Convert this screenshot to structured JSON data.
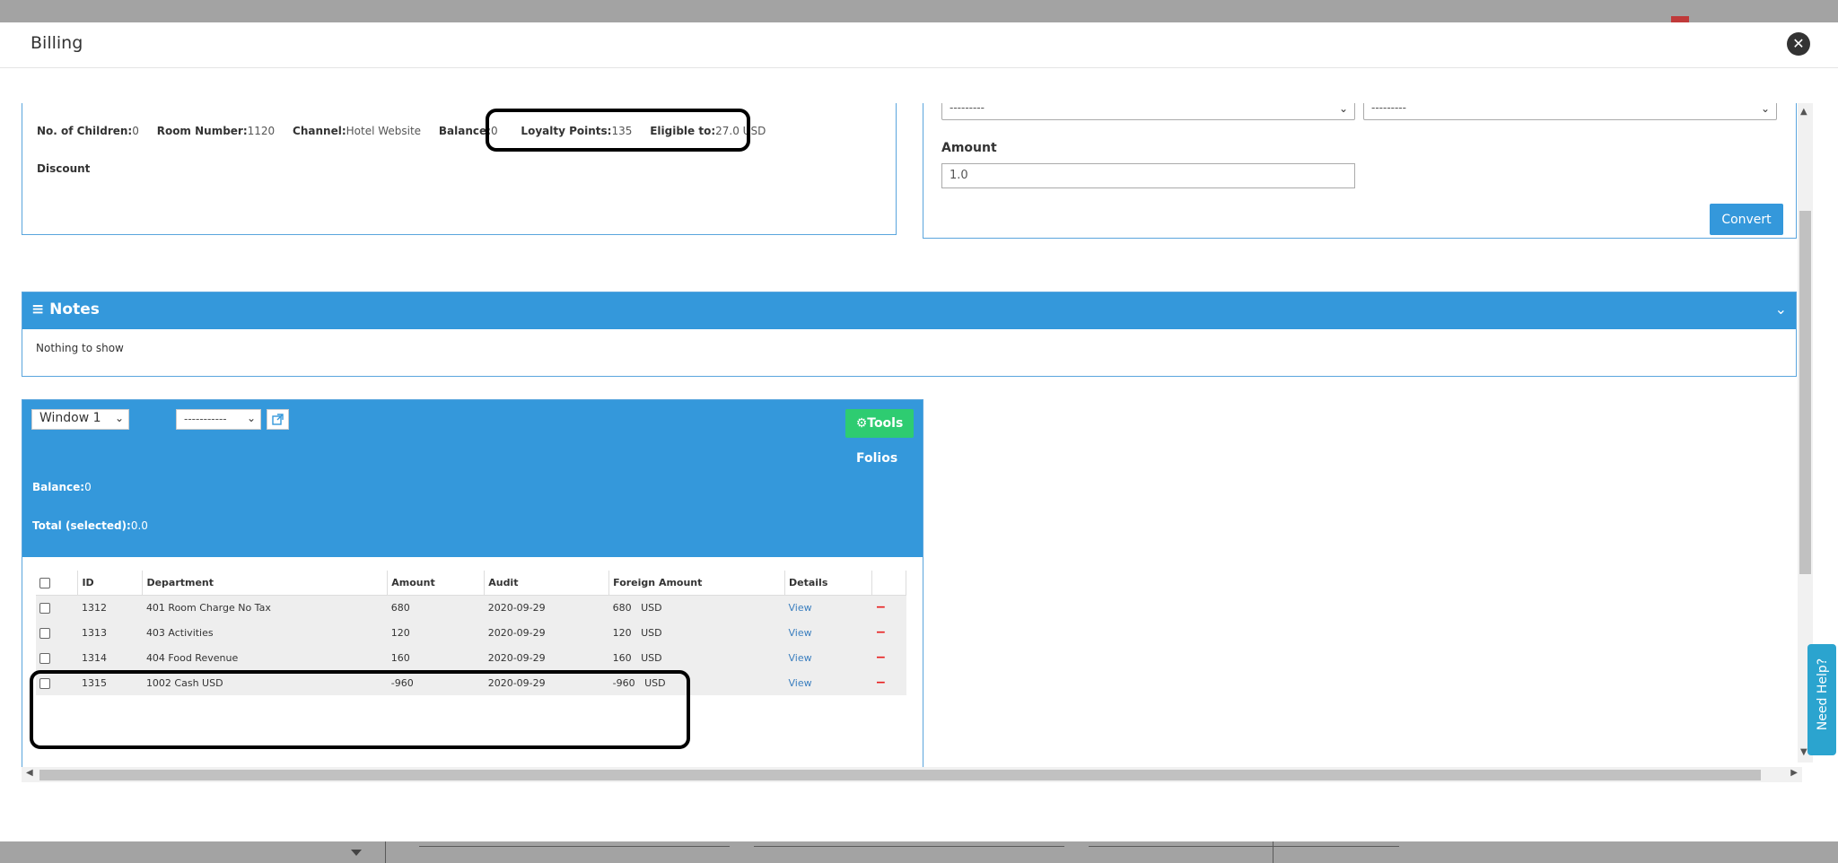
{
  "modal": {
    "title": "Billing",
    "close_icon": "close-circle-icon"
  },
  "reservation_info": {
    "children_label": "No. of Children:",
    "children_value": "0",
    "room_label": "Room Number:",
    "room_value": "1120",
    "channel_label": "Channel:",
    "channel_value": "Hotel Website",
    "balance_label": "Balance:",
    "balance_value": "0",
    "loyalty_label": "Loyalty Points:",
    "loyalty_value": "135",
    "eligible_label": "Eligible to:",
    "eligible_value": "27.0 USD",
    "discount_label": "Discount"
  },
  "converter": {
    "from_currency": "---------",
    "to_currency": "---------",
    "amount_label": "Amount",
    "amount_value": "1.0",
    "convert_label": "Convert"
  },
  "notes": {
    "title": "Notes",
    "icon": "menu-lines-icon",
    "empty_text": "Nothing to show"
  },
  "folio": {
    "window_select": "Window 1",
    "dash_select": "-----------",
    "tools_label": "Tools",
    "folios_label": "Folios",
    "balance_label": "Balance:",
    "balance_value": "0",
    "total_label": "Total (selected):",
    "total_value": "0.0"
  },
  "table": {
    "headers": [
      "ID",
      "Department",
      "Amount",
      "Audit",
      "Foreign Amount",
      "Details"
    ],
    "rows": [
      {
        "id": "1312",
        "department": "401 Room Charge No Tax",
        "amount": "680",
        "audit": "2020-09-29",
        "foreign": "680   USD",
        "details": "View"
      },
      {
        "id": "1313",
        "department": "403 Activities",
        "amount": "120",
        "audit": "2020-09-29",
        "foreign": "120   USD",
        "details": "View"
      },
      {
        "id": "1314",
        "department": "404 Food Revenue",
        "amount": "160",
        "audit": "2020-09-29",
        "foreign": "160   USD",
        "details": "View"
      },
      {
        "id": "1315",
        "department": "1002 Cash USD",
        "amount": "-960",
        "audit": "2020-09-29",
        "foreign": "-960   USD",
        "details": "View"
      }
    ],
    "remove_symbol": "−"
  },
  "help": {
    "label": "Need Help?"
  }
}
